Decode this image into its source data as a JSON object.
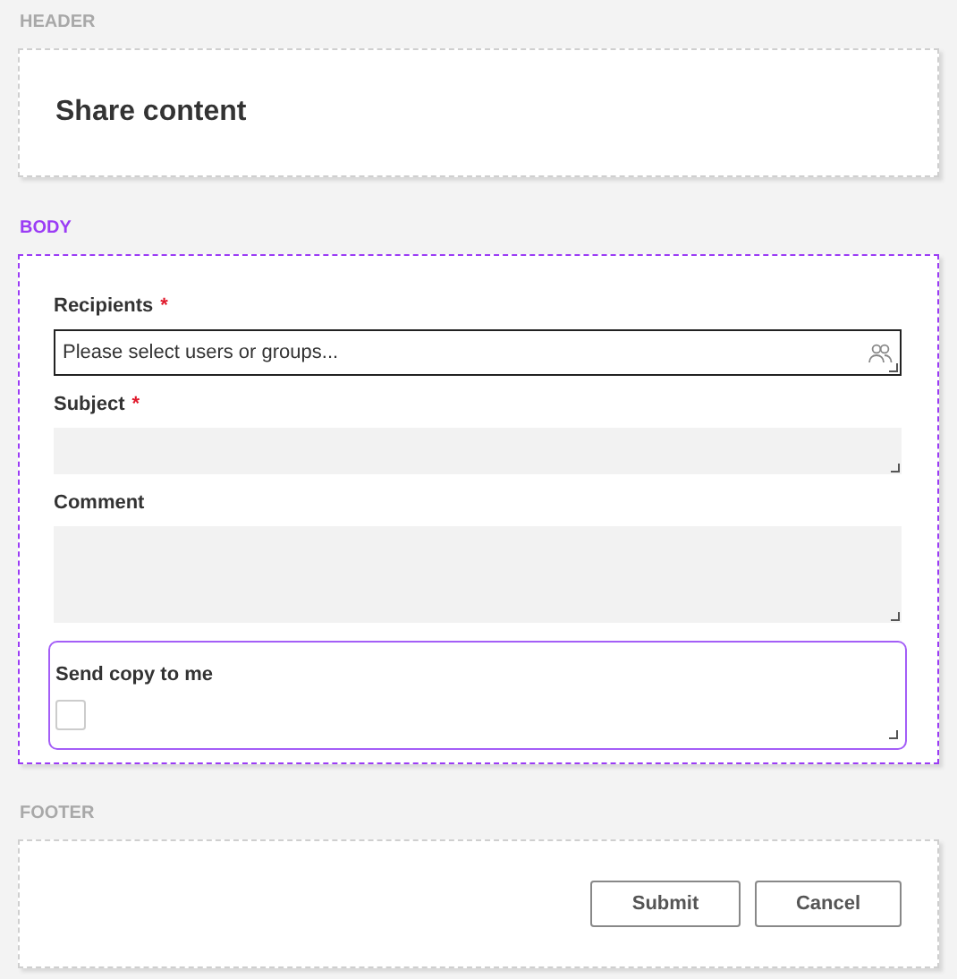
{
  "sections": [
    {
      "kind": "header",
      "label": "HEADER",
      "selected": false,
      "title": "Share content"
    },
    {
      "kind": "body",
      "label": "BODY",
      "selected": true,
      "fields": [
        {
          "kind": "picker",
          "label": "Recipients",
          "required": "*",
          "placeholder": "Please select users or groups...",
          "selected": false
        },
        {
          "kind": "text",
          "label": "Subject",
          "required": "*",
          "selected": false
        },
        {
          "kind": "textarea",
          "label": "Comment",
          "selected": false
        },
        {
          "kind": "checkbox",
          "label": "Send copy to me",
          "checked": false,
          "selected": true
        }
      ]
    },
    {
      "kind": "footer",
      "label": "FOOTER",
      "selected": false,
      "buttons": [
        "Submit",
        "Cancel"
      ]
    }
  ]
}
